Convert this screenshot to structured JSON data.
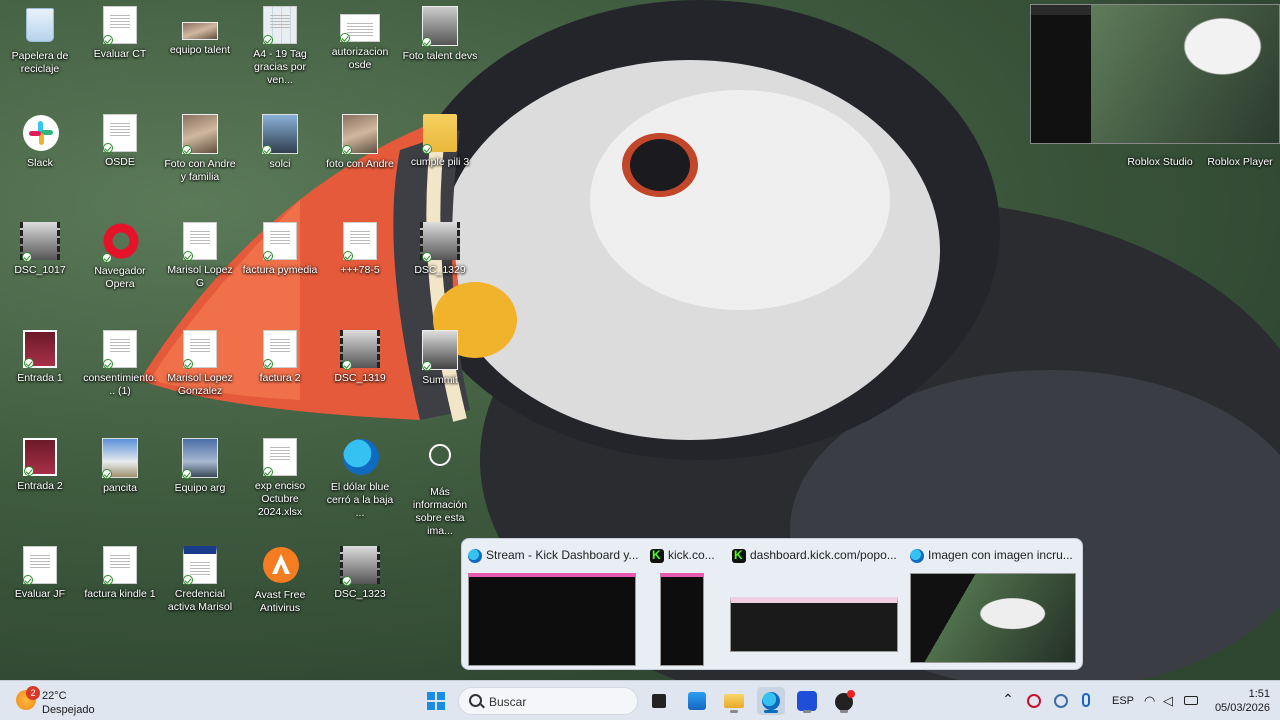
{
  "desktop": {
    "icons": [
      {
        "label": "Papelera de reciclaje",
        "icon": "recycle-bin-icon"
      },
      {
        "label": "Evaluar CT",
        "icon": "document-icon"
      },
      {
        "label": "equipo talent",
        "icon": "image-icon"
      },
      {
        "label": "A4 - 19 Tag gracias por ven...",
        "icon": "document-icon"
      },
      {
        "label": "autorizacion osde",
        "icon": "document-icon"
      },
      {
        "label": "Foto talent devs",
        "icon": "image-icon"
      },
      {
        "label": "Slack",
        "icon": "slack-icon"
      },
      {
        "label": "OSDE",
        "icon": "document-icon"
      },
      {
        "label": "Foto con Andre y familia",
        "icon": "image-icon"
      },
      {
        "label": "solci",
        "icon": "image-icon"
      },
      {
        "label": "foto con Andre",
        "icon": "image-icon"
      },
      {
        "label": "cumple pili 3",
        "icon": "folder-icon"
      },
      {
        "label": "DSC_1017",
        "icon": "video-icon"
      },
      {
        "label": "Navegador Opera",
        "icon": "opera-icon"
      },
      {
        "label": "Marisol Lopez G",
        "icon": "document-icon"
      },
      {
        "label": "factura pymedia",
        "icon": "document-icon"
      },
      {
        "label": "+++78-5",
        "icon": "document-icon"
      },
      {
        "label": "DSC_1329",
        "icon": "video-icon"
      },
      {
        "label": "Entrada 1",
        "icon": "ticket-icon"
      },
      {
        "label": "consentimiento... (1)",
        "icon": "document-icon"
      },
      {
        "label": "Marisol Lopez Gonzalez",
        "icon": "document-icon"
      },
      {
        "label": "factura 2",
        "icon": "document-icon"
      },
      {
        "label": "DSC_1319",
        "icon": "video-icon"
      },
      {
        "label": "Summit",
        "icon": "image-icon"
      },
      {
        "label": "Entrada 2",
        "icon": "ticket-icon"
      },
      {
        "label": "pancita",
        "icon": "image-icon"
      },
      {
        "label": "Equipo arg",
        "icon": "image-icon"
      },
      {
        "label": "exp enciso Octubre 2024.xlsx",
        "icon": "spreadsheet-icon"
      },
      {
        "label": "El dólar blue cerró a la baja ...",
        "icon": "edge-icon"
      },
      {
        "label": "Más información sobre esta ima...",
        "icon": "info-camera-icon"
      },
      {
        "label": "Evaluar JF",
        "icon": "document-icon"
      },
      {
        "label": "factura kindle 1",
        "icon": "document-icon"
      },
      {
        "label": "Credencial activa Marisol",
        "icon": "document-icon"
      },
      {
        "label": "Avast Free Antivirus",
        "icon": "avast-icon"
      },
      {
        "label": "DSC_1323",
        "icon": "video-icon"
      },
      {
        "label": "Roblox Studio",
        "icon": "roblox-studio-icon"
      },
      {
        "label": "Roblox Player",
        "icon": "roblox-player-icon"
      }
    ]
  },
  "preview": {
    "items": [
      {
        "title": "Stream - Kick Dashboard y...",
        "icon": "edge-icon"
      },
      {
        "title": "kick.co...",
        "icon": "kick-icon"
      },
      {
        "title": "dashboard.kick.com/popo...",
        "icon": "kick-icon"
      },
      {
        "title": "Imagen con imagen incru...",
        "icon": "edge-icon"
      }
    ]
  },
  "taskbar": {
    "weather_temp": "22°C",
    "weather_desc": "Despejado",
    "weather_badge": "2",
    "search_placeholder": "Buscar",
    "language": "ESP",
    "time": "1:51",
    "date": "05/03/2026"
  },
  "colors": {
    "accent": "#0f6cbd",
    "kick_green": "#53fc18"
  }
}
